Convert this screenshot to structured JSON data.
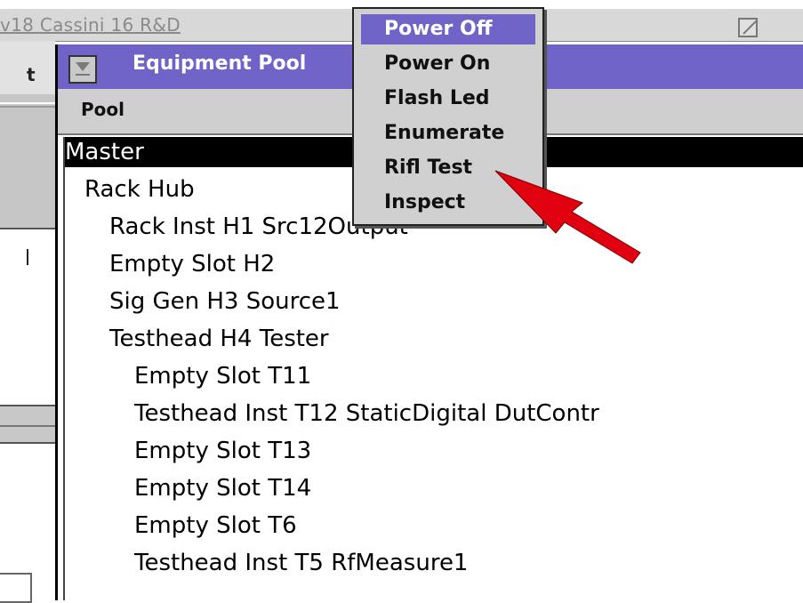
{
  "background_window": {
    "title": "v18 Cassini 16 R&D",
    "menu_letter": "t"
  },
  "equipment_pool": {
    "title": "Equipment Pool",
    "menu": {
      "pool_label": "Pool"
    },
    "tree": [
      {
        "label": "Master",
        "selected": true
      },
      {
        "label": "Rack Hub"
      },
      {
        "label": "Rack Inst H1   Src12Output"
      },
      {
        "label": "Empty Slot H2"
      },
      {
        "label": "Sig Gen H3   Source1"
      },
      {
        "label": "Testhead H4   Tester"
      },
      {
        "label": "Empty Slot T11"
      },
      {
        "label": "Testhead Inst T12   StaticDigital DutContr"
      },
      {
        "label": "Empty Slot T13"
      },
      {
        "label": "Empty Slot T14"
      },
      {
        "label": "Empty Slot T6"
      },
      {
        "label": "Testhead Inst T5   RfMeasure1"
      }
    ]
  },
  "popup_menu": {
    "items": [
      {
        "label": "Power Off",
        "highlighted": true
      },
      {
        "label": "Power On"
      },
      {
        "label": "Flash Led"
      },
      {
        "label": "Enumerate"
      },
      {
        "label": "Rifl Test"
      },
      {
        "label": "Inspect"
      }
    ]
  },
  "colors": {
    "title_bar": "#6f63c8",
    "highlight": "#6f63c8",
    "selected_row": "#000000",
    "arrow": "#e0000f"
  }
}
